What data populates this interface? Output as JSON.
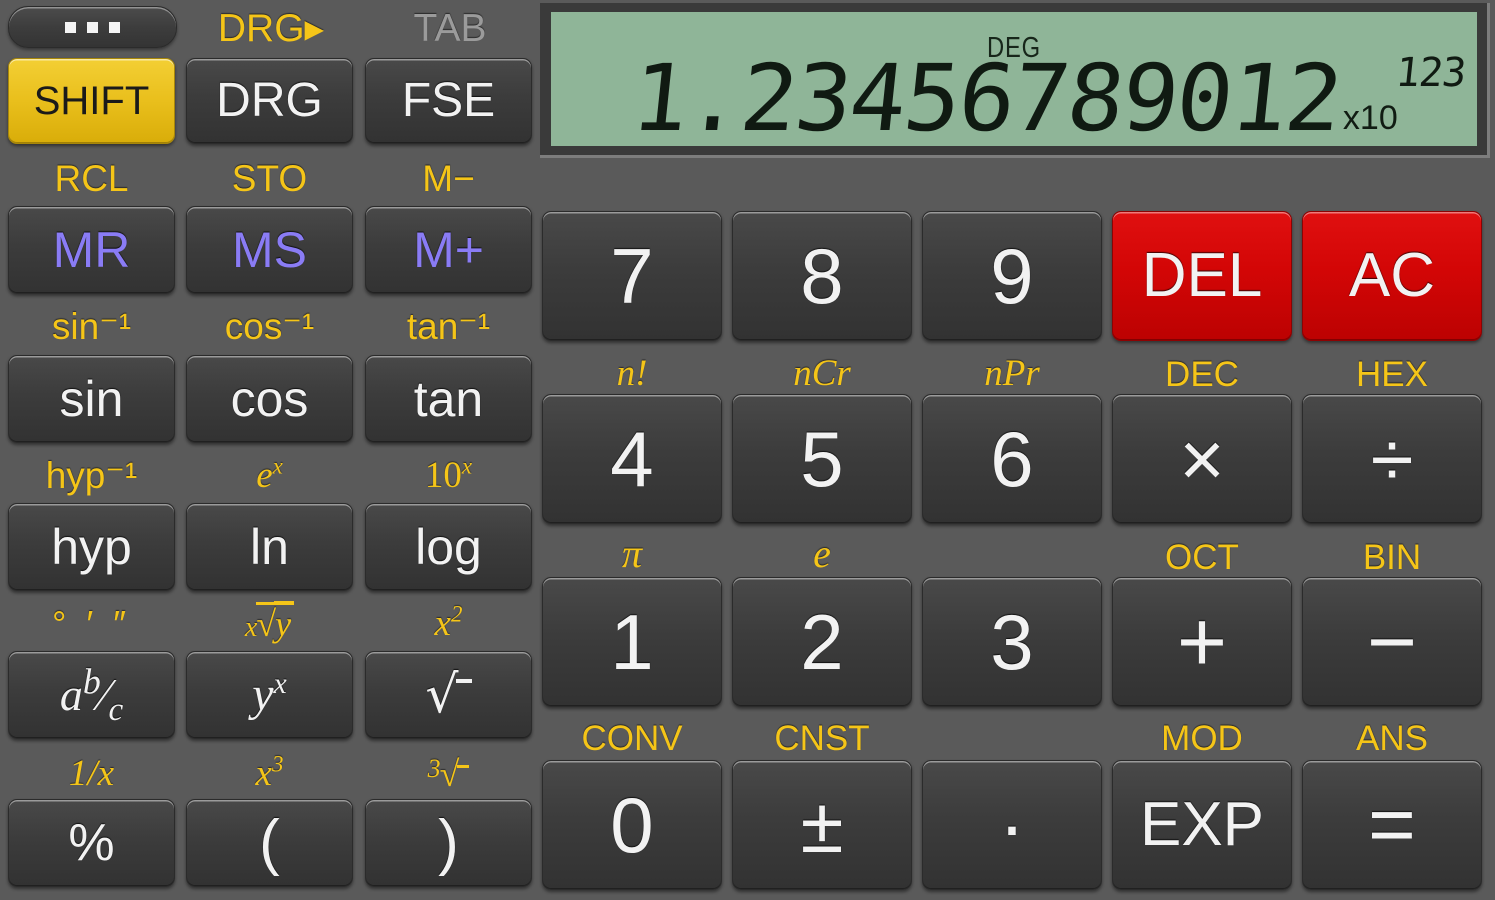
{
  "app": {
    "title": "RealCalc Scientific Calculator",
    "background_color": "#5a5a5a",
    "accent_yellow": "#f5c518",
    "memory_violet": "#8a7cf5",
    "danger_red": "#d30606",
    "lcd_color": "#8fb598"
  },
  "menu": {
    "name": "overflow-menu",
    "dots": 3
  },
  "display": {
    "angle_mode": "DEG",
    "mantissa": "1.23456789012",
    "exponent_prefix": "x10",
    "exponent": "123",
    "full_value": "1.23456789012x10^123"
  },
  "top_row": {
    "tab_label": "TAB",
    "drg_shift_label": "DRG▸",
    "keys": [
      {
        "label": "SHIFT",
        "style": "shift",
        "sub": "",
        "sub_below": "RCL"
      },
      {
        "label": "DRG",
        "style": "dark",
        "sub": "DRG▸",
        "sub_below": "STO"
      },
      {
        "label": "FSE",
        "style": "dark",
        "sub": "TAB",
        "sub_below": "M−"
      }
    ]
  },
  "left_panel": {
    "rows": [
      {
        "sub_labels": [
          "RCL",
          "STO",
          "M−"
        ],
        "keys": [
          {
            "label": "MR",
            "style": "mem"
          },
          {
            "label": "MS",
            "style": "mem"
          },
          {
            "label": "M+",
            "style": "mem"
          }
        ]
      },
      {
        "sub_labels": [
          "sin⁻¹",
          "cos⁻¹",
          "tan⁻¹"
        ],
        "keys": [
          {
            "label": "sin",
            "style": "dark"
          },
          {
            "label": "cos",
            "style": "dark"
          },
          {
            "label": "tan",
            "style": "dark"
          }
        ]
      },
      {
        "sub_labels": [
          "hyp⁻¹",
          "eˣ",
          "10ˣ"
        ],
        "keys": [
          {
            "label": "hyp",
            "style": "dark"
          },
          {
            "label": "ln",
            "style": "dark"
          },
          {
            "label": "log",
            "style": "dark"
          }
        ]
      },
      {
        "sub_labels": [
          "° ′ ″",
          "ˣ√y",
          "x²"
        ],
        "keys": [
          {
            "label": "a b/c",
            "style": "dark"
          },
          {
            "label": "yˣ",
            "style": "dark"
          },
          {
            "label": "√",
            "style": "dark"
          }
        ]
      },
      {
        "sub_labels": [
          "1/x",
          "x³",
          "³√"
        ],
        "keys": [
          {
            "label": "%",
            "style": "dark"
          },
          {
            "label": "(",
            "style": "dark"
          },
          {
            "label": ")",
            "style": "dark"
          }
        ]
      }
    ]
  },
  "keypad": {
    "rows": [
      {
        "keys": [
          {
            "label": "7",
            "style": "dark",
            "sub_below": "n!"
          },
          {
            "label": "8",
            "style": "dark",
            "sub_below": "nCr"
          },
          {
            "label": "9",
            "style": "dark",
            "sub_below": "nPr"
          },
          {
            "label": "DEL",
            "style": "red",
            "sub_below": "DEC"
          },
          {
            "label": "AC",
            "style": "red",
            "sub_below": "HEX"
          }
        ]
      },
      {
        "keys": [
          {
            "label": "4",
            "style": "dark",
            "sub_below": "π"
          },
          {
            "label": "5",
            "style": "dark",
            "sub_below": "e"
          },
          {
            "label": "6",
            "style": "dark",
            "sub_below": ""
          },
          {
            "label": "×",
            "style": "dark",
            "sub_below": "OCT"
          },
          {
            "label": "÷",
            "style": "dark",
            "sub_below": "BIN"
          }
        ]
      },
      {
        "keys": [
          {
            "label": "1",
            "style": "dark",
            "sub_below": "CONV"
          },
          {
            "label": "2",
            "style": "dark",
            "sub_below": "CNST"
          },
          {
            "label": "3",
            "style": "dark",
            "sub_below": ""
          },
          {
            "label": "+",
            "style": "dark",
            "sub_below": "MOD"
          },
          {
            "label": "−",
            "style": "dark",
            "sub_below": "ANS"
          }
        ]
      },
      {
        "keys": [
          {
            "label": "0",
            "style": "dark",
            "sub_below": ""
          },
          {
            "label": "±",
            "style": "dark",
            "sub_below": ""
          },
          {
            "label": "·",
            "style": "dark",
            "sub_below": ""
          },
          {
            "label": "EXP",
            "style": "dark",
            "sub_below": ""
          },
          {
            "label": "=",
            "style": "dark",
            "sub_below": ""
          }
        ]
      }
    ]
  }
}
